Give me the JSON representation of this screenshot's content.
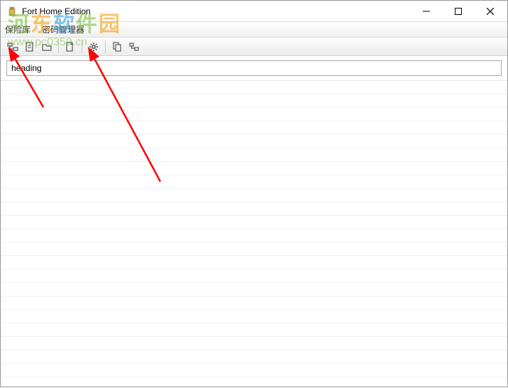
{
  "window": {
    "title": "Fort Home Edition"
  },
  "menubar": {
    "item0": "保险库",
    "item1": "密码管理器"
  },
  "toolbar": {
    "btn0": "folder-tree-icon",
    "btn1": "new-item-icon",
    "btn2": "open-icon",
    "btn3": "edit-icon",
    "btn4": "settings-icon",
    "btn5": "copy-icon",
    "btn6": "network-icon"
  },
  "search": {
    "value": "heading"
  },
  "watermark": {
    "text": "河东软件园",
    "url": "www.pc0359.cn"
  }
}
